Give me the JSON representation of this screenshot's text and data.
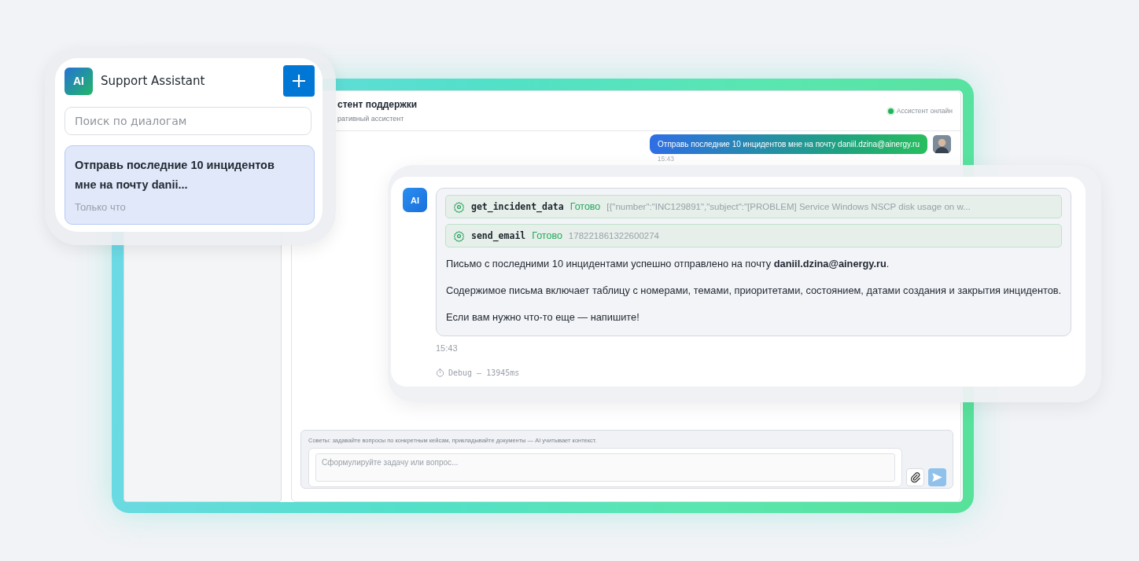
{
  "sidebar_card": {
    "logo": "AI",
    "title": "Support Assistant",
    "search": {
      "placeholder": "Поиск по диалогам"
    },
    "conversations": [
      {
        "title": "Отправь последние 10 инцидентов мне на почту danii...",
        "time": "Только что",
        "selected": true
      }
    ]
  },
  "chat": {
    "title": "стент поддержки",
    "subtitle": "ративный ассистент",
    "status": {
      "label": "Ассистент онлайн",
      "online": true
    },
    "messages": [
      {
        "kind": "user",
        "text": "Отправь последние 10 инцидентов мне на почту daniil.dzina@ainergy.ru",
        "time": "15:43"
      },
      {
        "kind": "assistant",
        "avatar": "AI",
        "tool_calls": [
          {
            "name": "get_incident_data",
            "status": "Готово",
            "result": "[{\"number\":\"INC129891\",\"subject\":\"[PROBLEM] Service Windows NSCP disk usage on w..."
          },
          {
            "name": "send_email",
            "status": "Готово",
            "result": "178221861322600274"
          }
        ],
        "paragraphs": [
          "Письмо с последними 10 инцидентами успешно отправлено на почту **daniil.dzina@ainergy.ru**.",
          "Содержимое письма включает таблицу с номерами, темами, приоритетами, состоянием, датами создания и закрытия инцидентов.",
          "Если вам нужно что-то еще — напишите!"
        ],
        "time": "15:43",
        "debug": "Debug — 13945ms"
      }
    ]
  },
  "composer": {
    "hint": "Советы: задавайте вопросы по конкретным кейсам, прикладывайте документы — AI учитывает контекст.",
    "placeholder": "Сформулируйте задачу или вопрос..."
  }
}
